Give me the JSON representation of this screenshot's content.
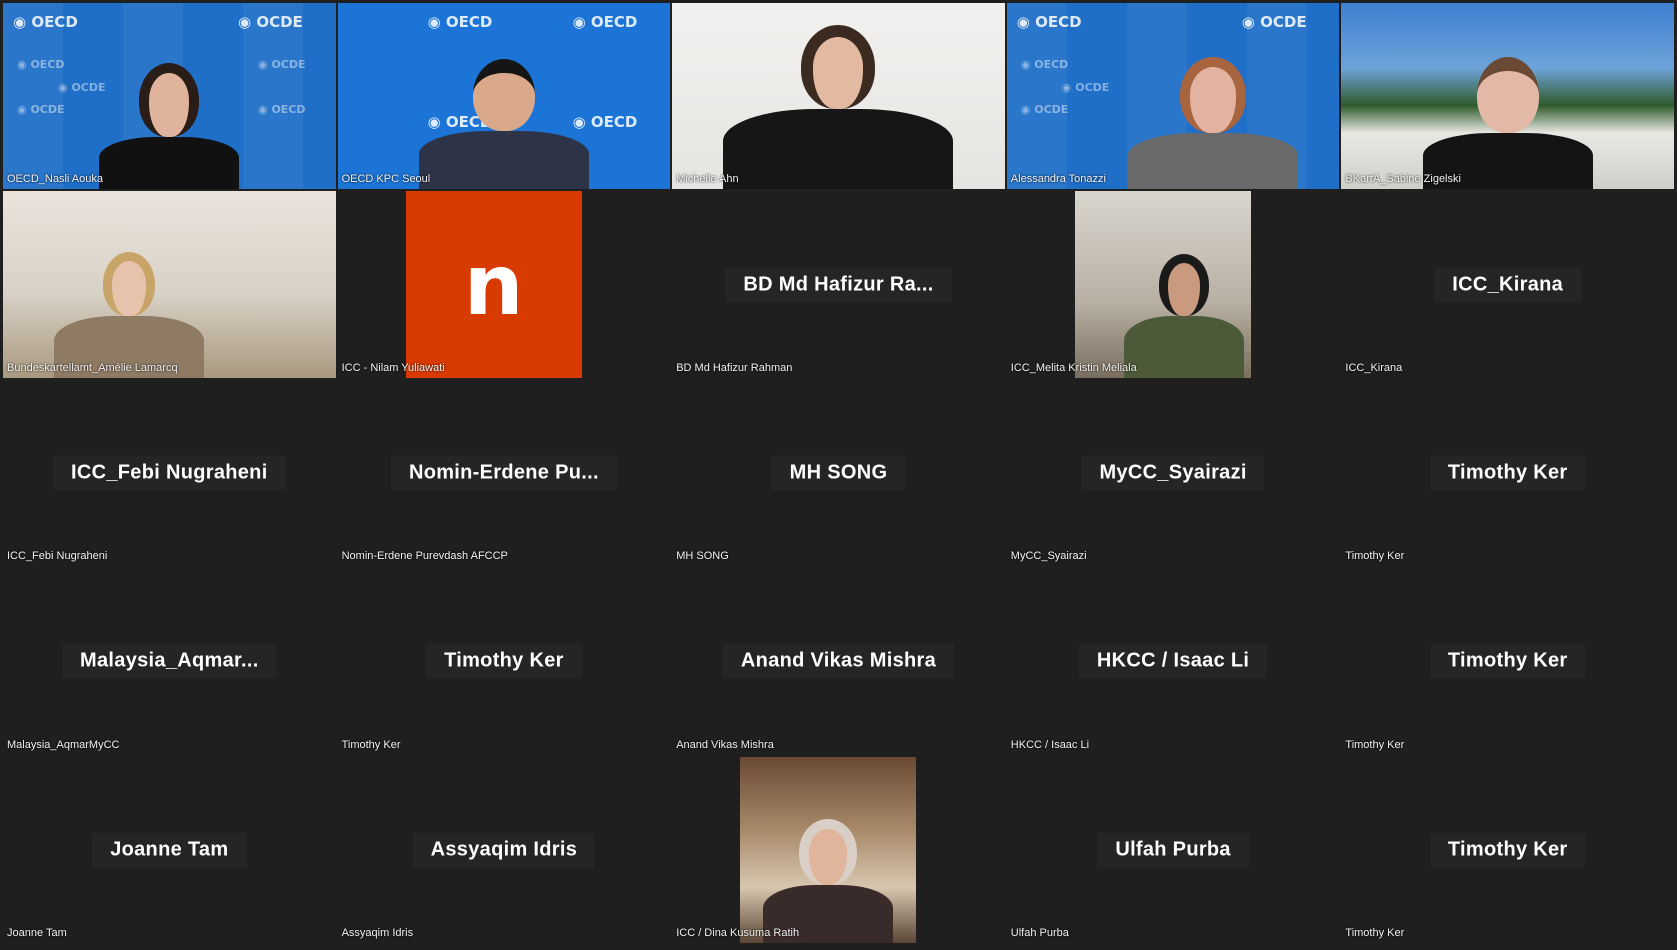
{
  "tiles": [
    {
      "label": "OECD_Nasli Aouka",
      "type": "video",
      "bg": "oecd"
    },
    {
      "label": "OECD KPC Seoul",
      "type": "video",
      "bg": "oecd2"
    },
    {
      "label": "Michelle Ahn",
      "type": "video",
      "bg": "white"
    },
    {
      "label": "Alessandra Tonazzi",
      "type": "video",
      "bg": "oecd"
    },
    {
      "label": "BKartA_Sabine Zigelski",
      "type": "video",
      "bg": "outdoor"
    },
    {
      "label": "Bundeskartellamt_Amélie Lamarcq",
      "type": "video",
      "bg": "office"
    },
    {
      "label": "ICC - Nilam Yuliawati",
      "type": "avatar",
      "initial": "n",
      "color": "#d83b01"
    },
    {
      "label": "BD Md Hafizur Rahman",
      "type": "name",
      "display": "BD Md Hafizur Ra..."
    },
    {
      "label": "ICC_Melita Kristin Meliala",
      "type": "video",
      "bg": "room"
    },
    {
      "label": "ICC_Kirana",
      "type": "name",
      "display": "ICC_Kirana"
    },
    {
      "label": "ICC_Febi Nugraheni",
      "type": "name",
      "display": "ICC_Febi Nugraheni"
    },
    {
      "label": "Nomin-Erdene Purevdash AFCCP",
      "type": "name",
      "display": "Nomin-Erdene  Pu..."
    },
    {
      "label": "MH SONG",
      "type": "name",
      "display": "MH SONG"
    },
    {
      "label": "MyCC_Syairazi",
      "type": "name",
      "display": "MyCC_Syairazi"
    },
    {
      "label": "Timothy Ker",
      "type": "name",
      "display": "Timothy Ker"
    },
    {
      "label": "Malaysia_AqmarMyCC",
      "type": "name",
      "display": "Malaysia_Aqmar..."
    },
    {
      "label": "Timothy Ker",
      "type": "name",
      "display": "Timothy Ker"
    },
    {
      "label": "Anand Vikas Mishra",
      "type": "name",
      "display": "Anand Vikas Mishra"
    },
    {
      "label": "HKCC / Isaac Li",
      "type": "name",
      "display": "HKCC / Isaac Li"
    },
    {
      "label": "Timothy Ker",
      "type": "name",
      "display": "Timothy Ker"
    },
    {
      "label": "Joanne Tam",
      "type": "name",
      "display": "Joanne Tam"
    },
    {
      "label": "Assyaqim Idris",
      "type": "name",
      "display": "Assyaqim Idris"
    },
    {
      "label": "ICC / Dina Kusuma Ratih",
      "type": "video",
      "bg": "cafe"
    },
    {
      "label": "Ulfah Purba",
      "type": "name",
      "display": "Ulfah Purba"
    },
    {
      "label": "Timothy Ker",
      "type": "name",
      "display": "Timothy Ker"
    }
  ],
  "oecd_logo_text": "OECD",
  "ocde_logo_text": "OCDE",
  "colors": {
    "tile_bg": "#1f1f1f",
    "oecd_blue": "#1f6fc8",
    "avatar_orange": "#d83b01"
  }
}
